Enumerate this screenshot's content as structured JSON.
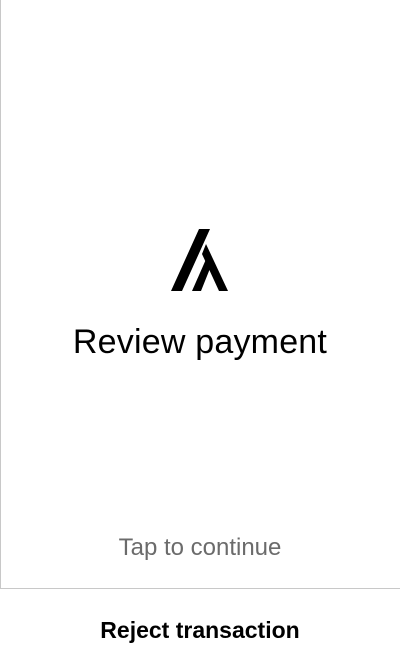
{
  "screen": {
    "logo_icon": "algorand-logo-icon",
    "title": "Review payment",
    "tap_hint": "Tap to continue"
  },
  "footer": {
    "reject_label": "Reject transaction"
  },
  "colors": {
    "background": "#ffffff",
    "text_primary": "#000000",
    "text_secondary": "#6b6b6b",
    "divider": "#c8c8c8"
  }
}
